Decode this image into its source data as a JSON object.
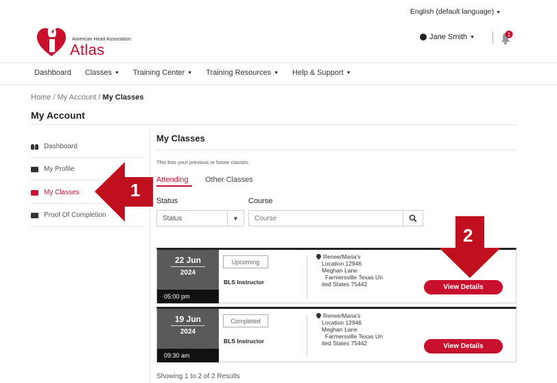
{
  "header": {
    "language": "English (default language)",
    "org_name": "American Heart Association.",
    "brand": "Atlas",
    "user_name": "Jane Smith",
    "notification_count": "1"
  },
  "nav": {
    "items": [
      {
        "label": "Dashboard",
        "dropdown": false
      },
      {
        "label": "Classes",
        "dropdown": true
      },
      {
        "label": "Training Center",
        "dropdown": true
      },
      {
        "label": "Training Resources",
        "dropdown": true
      },
      {
        "label": "Help & Support",
        "dropdown": true
      }
    ]
  },
  "breadcrumb": {
    "home": "Home",
    "sep": " / ",
    "account": "My Account",
    "current": "My Classes"
  },
  "page_title": "My Account",
  "sidebar": {
    "items": [
      {
        "label": "Dashboard",
        "icon": "people-icon",
        "active": false
      },
      {
        "label": "My Profile",
        "icon": "id-card-icon",
        "active": false
      },
      {
        "label": "My Classes",
        "icon": "id-card-icon",
        "active": true
      },
      {
        "label": "Proof Of Completion",
        "icon": "id-card-icon",
        "active": false
      }
    ]
  },
  "main": {
    "title": "My Classes",
    "intro": "This lists your previous or future classes.",
    "tabs": [
      {
        "label": "Attending",
        "active": true
      },
      {
        "label": "Other Classes",
        "active": false
      }
    ],
    "filters": {
      "status_label": "Status",
      "status_value": "Status",
      "course_label": "Course",
      "course_placeholder": "Course"
    },
    "classes": [
      {
        "day_month": "22 Jun",
        "year": "2024",
        "time": "05:00 pm",
        "status": "Upcoming",
        "course": "BLS Instructor",
        "location_lines": [
          "Renee/Maria's",
          "Location 12946",
          "Meghan Lane",
          "Farmersville Texas Un",
          "ited States 75442"
        ],
        "action": "View Details"
      },
      {
        "day_month": "19 Jun",
        "year": "2024",
        "time": "09:30 am",
        "status": "Completed",
        "course": "BLS Instructor",
        "location_lines": [
          "Renee/Maria's",
          "Location 12946",
          "Meghan Lane",
          "Farmersville Texas Un",
          "ited States 75442"
        ],
        "action": "View Details"
      }
    ],
    "results_text": "Showing 1 to 2 of 2 Results"
  },
  "annotations": {
    "arrow1_label": "1",
    "arrow2_label": "2",
    "arrow_color": "#c0101e"
  },
  "colors": {
    "brand_red": "#c8102e",
    "date_box": "#5a5a5a",
    "time_bar": "#111111"
  }
}
